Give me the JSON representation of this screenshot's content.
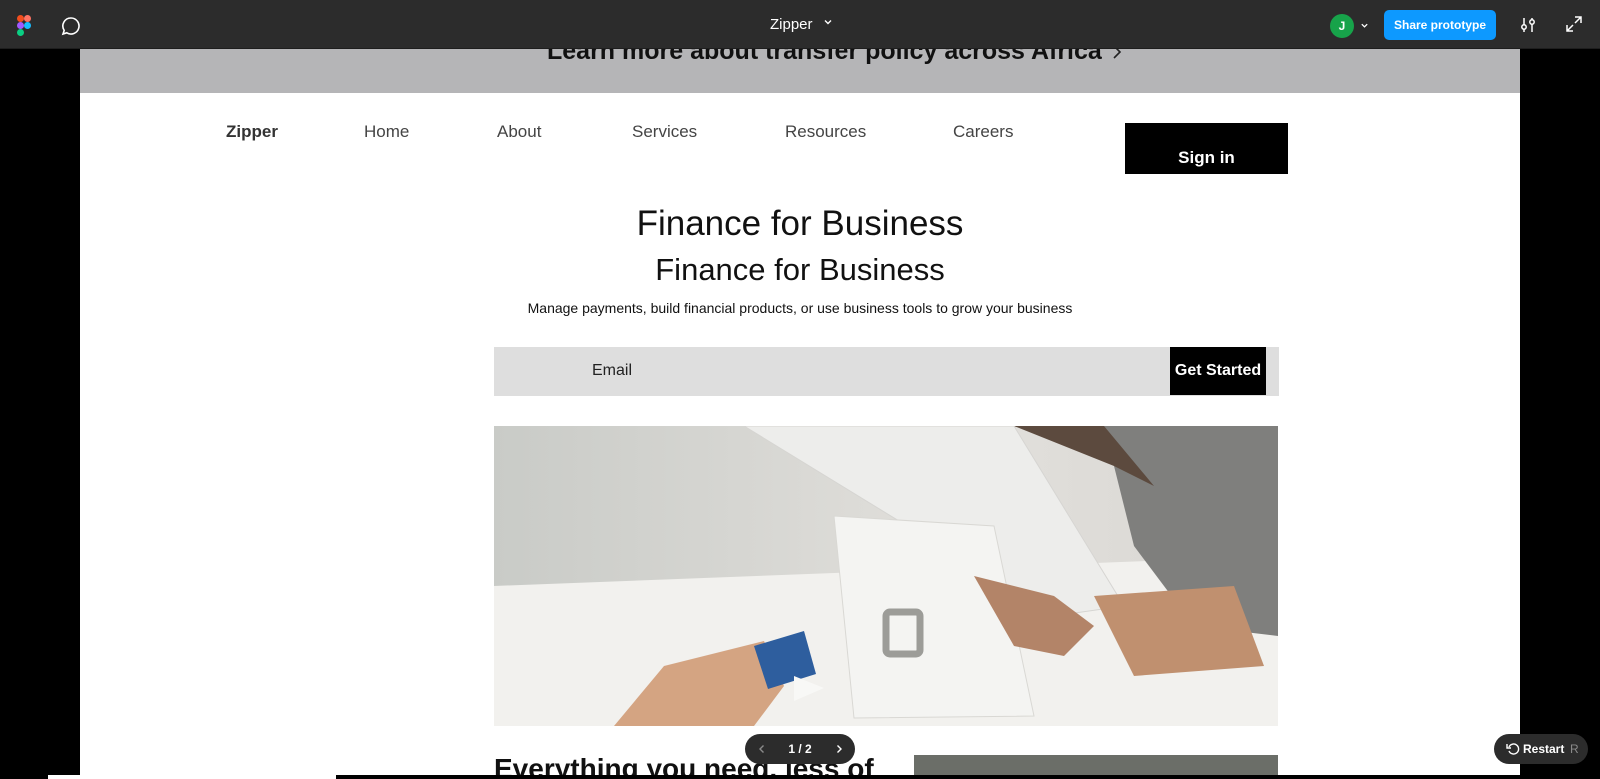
{
  "toolbar": {
    "title": "Zipper",
    "avatar_initial": "J",
    "share_label": "Share prototype",
    "icons": [
      "figma-logo-icon",
      "comment-icon",
      "chevron-down-icon",
      "settings-icon",
      "expand-icon"
    ]
  },
  "site": {
    "banner_text": "Learn more about transfer policy across Africa",
    "nav": {
      "brand": "Zipper",
      "links": [
        "Home",
        "About",
        "Services",
        "Resources",
        "Careers"
      ],
      "signin_label": "Sign in"
    },
    "hero": {
      "title": "Finance for Business",
      "subtitle": "Finance for Business",
      "description": "Manage  payments, build financial products, or use business tools to grow your business",
      "email_placeholder": "Email",
      "cta_label": "Get Started"
    },
    "section_title": "Everything you need, less of"
  },
  "player": {
    "page_indicator": "1 / 2",
    "restart_label": "Restart",
    "restart_shortcut": "R"
  },
  "colors": {
    "toolbar_bg": "#2c2c2c",
    "share_blue": "#0d99ff",
    "avatar_green": "#17a34a",
    "banner_gray": "#b5b5b7",
    "email_gray": "#dedede"
  }
}
